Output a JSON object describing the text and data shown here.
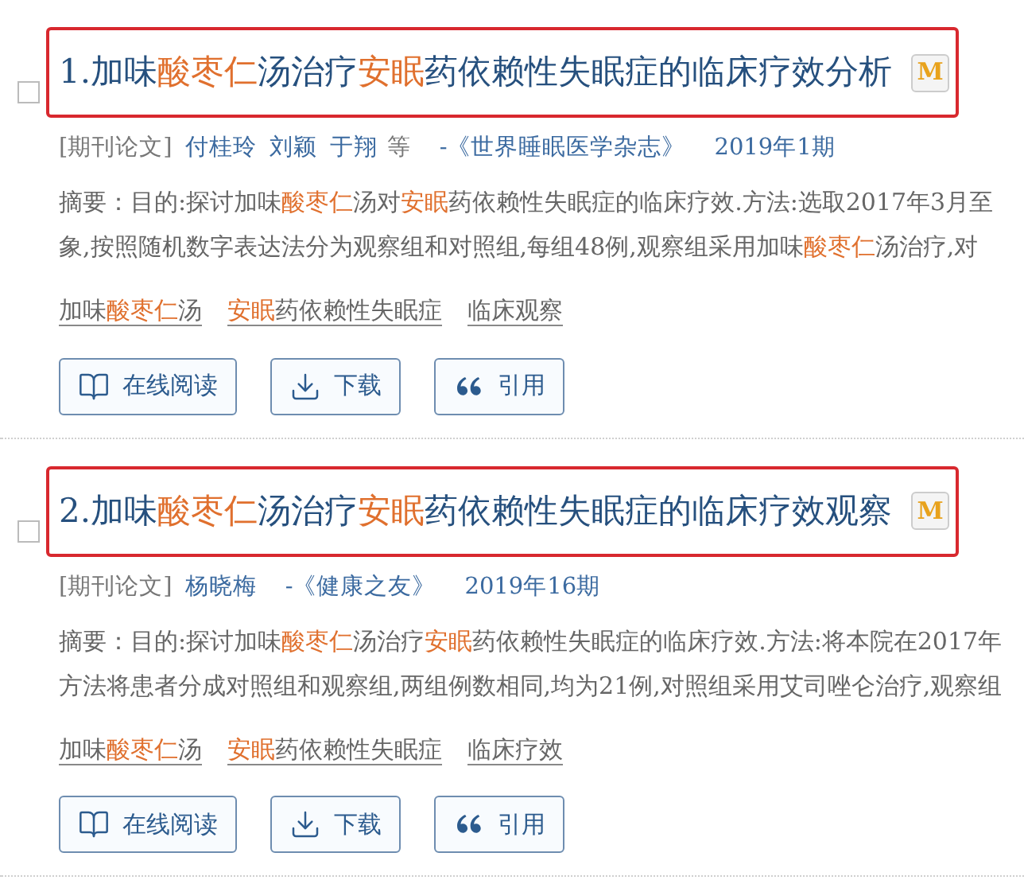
{
  "results": [
    {
      "checked": false,
      "boxed": true,
      "title": [
        {
          "text": "1.加味",
          "hl": false
        },
        {
          "text": "酸枣仁",
          "hl": true
        },
        {
          "text": "汤治疗",
          "hl": false
        },
        {
          "text": "安眠",
          "hl": true
        },
        {
          "text": "药依赖性失眠症的临床疗效分析",
          "hl": false
        }
      ],
      "badge": "M",
      "type": "[期刊论文]",
      "authors": [
        "付桂玲",
        "刘颖",
        "于翔"
      ],
      "more": "等",
      "source": "-《世界睡眠医学杂志》",
      "issue": "2019年1期",
      "abstract": [
        [
          {
            "text": "摘要：目的:探讨加味",
            "hl": false
          },
          {
            "text": "酸枣仁",
            "hl": true
          },
          {
            "text": "汤对",
            "hl": false
          },
          {
            "text": "安眠",
            "hl": true
          },
          {
            "text": "药依赖性失眠症的临床疗效.方法:选取2017年3月至",
            "hl": false
          }
        ],
        [
          {
            "text": "象,按照随机数字表达法分为观察组和对照组,每组48例,观察组采用加味",
            "hl": false
          },
          {
            "text": "酸枣仁",
            "hl": true
          },
          {
            "text": "汤治疗,对",
            "hl": false
          }
        ]
      ],
      "keywords": [
        [
          {
            "text": "加味",
            "hl": false
          },
          {
            "text": "酸枣仁",
            "hl": true
          },
          {
            "text": "汤",
            "hl": false
          }
        ],
        [
          {
            "text": "安眠",
            "hl": true
          },
          {
            "text": "药依赖性失眠症",
            "hl": false
          }
        ],
        [
          {
            "text": "临床观察",
            "hl": false
          }
        ]
      ],
      "buttons": [
        {
          "kind": "read",
          "label": "在线阅读"
        },
        {
          "kind": "download",
          "label": "下载"
        },
        {
          "kind": "cite",
          "label": "引用"
        }
      ]
    },
    {
      "checked": false,
      "boxed": true,
      "title": [
        {
          "text": "2.加味",
          "hl": false
        },
        {
          "text": "酸枣仁",
          "hl": true
        },
        {
          "text": "汤治疗",
          "hl": false
        },
        {
          "text": "安眠",
          "hl": true
        },
        {
          "text": "药依赖性失眠症的临床疗效观察",
          "hl": false
        }
      ],
      "badge": "M",
      "type": "[期刊论文]",
      "authors": [
        "杨晓梅"
      ],
      "source": "-《健康之友》",
      "issue": "2019年16期",
      "abstract": [
        [
          {
            "text": "摘要：目的:探讨加味",
            "hl": false
          },
          {
            "text": "酸枣仁",
            "hl": true
          },
          {
            "text": "汤治疗",
            "hl": false
          },
          {
            "text": "安眠",
            "hl": true
          },
          {
            "text": "药依赖性失眠症的临床疗效.方法:将本院在2017年",
            "hl": false
          }
        ],
        [
          {
            "text": "方法将患者分成对照组和观察组,两组例数相同,均为21例,对照组采用艾司唑仑治疗,观察组",
            "hl": false
          }
        ]
      ],
      "keywords": [
        [
          {
            "text": "加味",
            "hl": false
          },
          {
            "text": "酸枣仁",
            "hl": true
          },
          {
            "text": "汤",
            "hl": false
          }
        ],
        [
          {
            "text": "安眠",
            "hl": true
          },
          {
            "text": "药依赖性失眠症",
            "hl": false
          }
        ],
        [
          {
            "text": "临床疗效",
            "hl": false
          }
        ]
      ],
      "buttons": [
        {
          "kind": "read",
          "label": "在线阅读"
        },
        {
          "kind": "download",
          "label": "下载"
        },
        {
          "kind": "cite",
          "label": "引用"
        }
      ]
    }
  ]
}
